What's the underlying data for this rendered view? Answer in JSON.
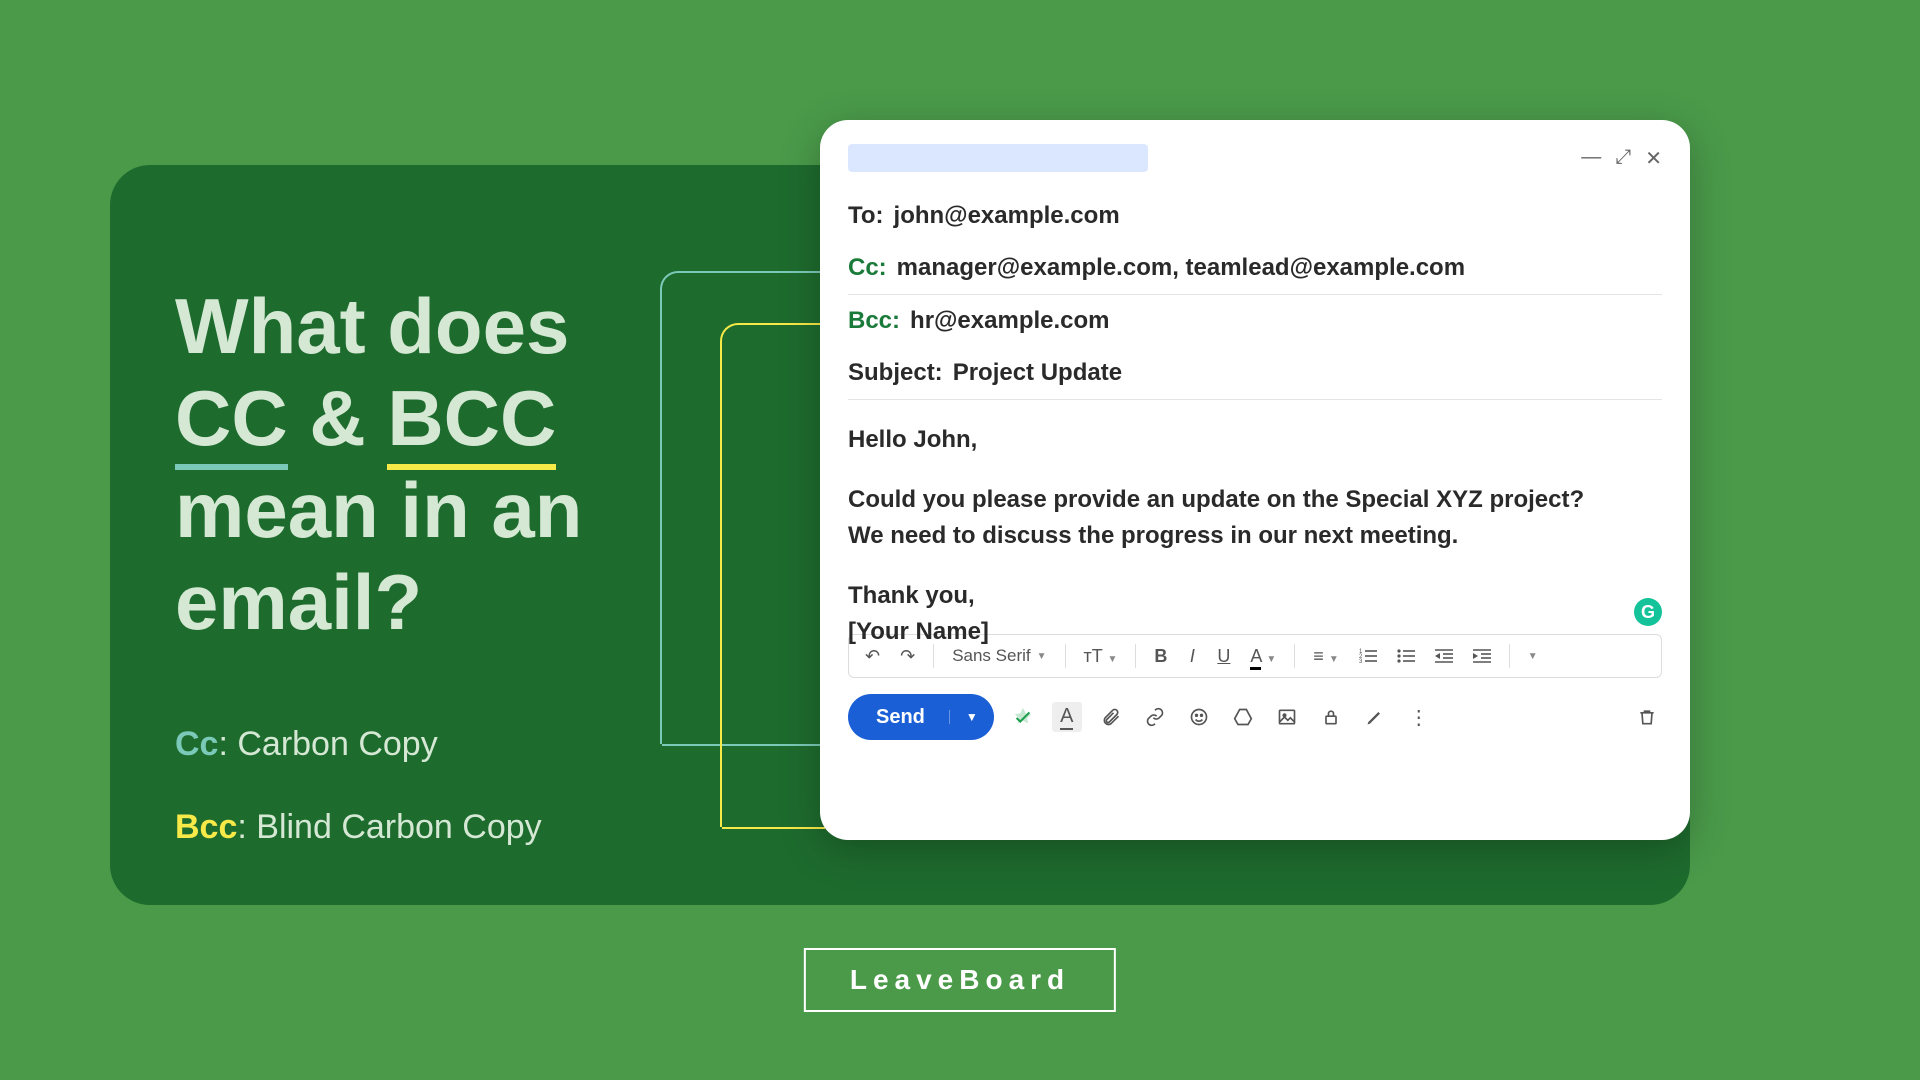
{
  "headline": {
    "line1": "What does",
    "cc": "CC",
    "amp": " & ",
    "bcc": "BCC",
    "line3a": "mean in an",
    "line3b": "email?"
  },
  "definitions": {
    "cc_label": "Cc",
    "cc_value": ": Carbon Copy",
    "bcc_label": "Bcc",
    "bcc_value": ": Blind Carbon Copy"
  },
  "compose": {
    "to_label": "To:",
    "to_value": "john@example.com",
    "cc_label": "Cc:",
    "cc_value": "manager@example.com, teamlead@example.com",
    "bcc_label": "Bcc:",
    "bcc_value": "hr@example.com",
    "subject_label": "Subject:",
    "subject_value": "Project Update",
    "greeting": "Hello John,",
    "para": "Could you please provide an update on the Special XYZ project? We need to discuss the progress in our next meeting.",
    "thanks": "Thank you,",
    "signature": "[Your Name]",
    "font_name": "Sans Serif",
    "send": "Send"
  },
  "brand": "LeaveBoard",
  "icons": {
    "grammarly": "G"
  }
}
